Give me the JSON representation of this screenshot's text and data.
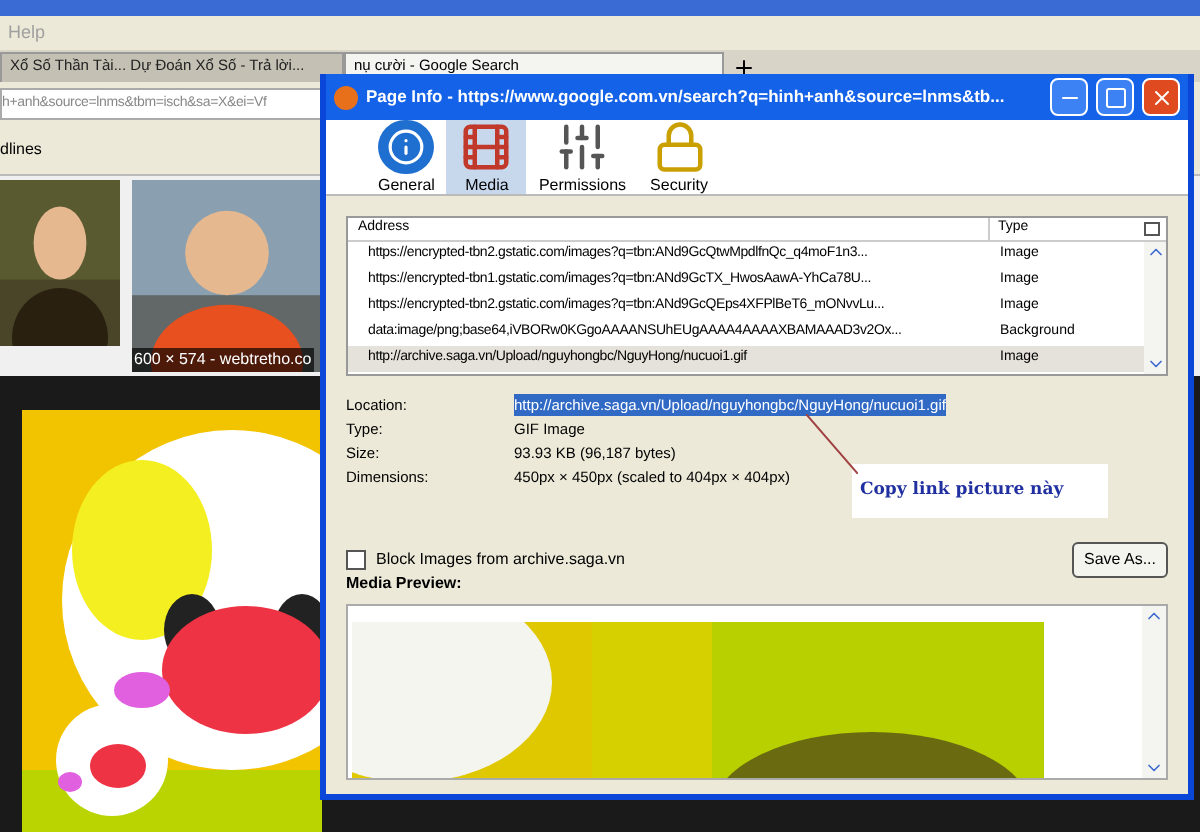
{
  "browser": {
    "menu": [
      "Help"
    ],
    "tabs": [
      {
        "label": "Xổ Số Thần Tài... Dự Đoán Xổ Số - Trả lời...",
        "selected": false
      },
      {
        "label": "nụ cười - Google Search",
        "selected": true
      }
    ],
    "address": "h+anh&source=lnms&tbm=isch&sa=X&ei=Vf",
    "bookmarks_label": "dlines",
    "image_caption": "600 × 574 - webtretho.co"
  },
  "dialog": {
    "title": "Page Info - https://www.google.com.vn/search?q=hinh+anh&source=lnms&tb...",
    "tabs": [
      {
        "label": "General",
        "kind": "general",
        "selected": false
      },
      {
        "label": "Media",
        "kind": "media",
        "selected": true
      },
      {
        "label": "Permissions",
        "kind": "permissions",
        "selected": false
      },
      {
        "label": "Security",
        "kind": "security",
        "selected": false
      }
    ],
    "list": {
      "columns": [
        "Address",
        "Type"
      ],
      "rows": [
        {
          "address": "https://encrypted-tbn2.gstatic.com/images?q=tbn:ANd9GcQtwMpdlfnQc_q4moF1n3...",
          "type": "Image",
          "selected": false
        },
        {
          "address": "https://encrypted-tbn1.gstatic.com/images?q=tbn:ANd9GcTX_HwosAawA-YhCa78U...",
          "type": "Image",
          "selected": false
        },
        {
          "address": "https://encrypted-tbn2.gstatic.com/images?q=tbn:ANd9GcQEps4XFPlBeT6_mONvvLu...",
          "type": "Image",
          "selected": false
        },
        {
          "address": "data:image/png;base64,iVBORw0KGgoAAAANSUhEUgAAAA4AAAAXBAMAAAD3v2Ox...",
          "type": "Background",
          "selected": false
        },
        {
          "address": "http://archive.saga.vn/Upload/nguyhongbc/NguyHong/nucuoi1.gif",
          "type": "Image",
          "selected": true
        }
      ]
    },
    "details": [
      {
        "label": "Location:",
        "value": "http://archive.saga.vn/Upload/nguyhongbc/NguyHong/nucuoi1.gif",
        "highlighted": true
      },
      {
        "label": "Type:",
        "value": "GIF Image",
        "highlighted": false
      },
      {
        "label": "Size:",
        "value": "93.93 KB (96,187 bytes)",
        "highlighted": false
      },
      {
        "label": "Dimensions:",
        "value": "450px × 450px (scaled to 404px × 404px)",
        "highlighted": false
      }
    ],
    "annotation": "Copy link picture này",
    "block_checkbox": {
      "label": "Block Images from archive.saga.vn",
      "checked": false
    },
    "preview_label": "Media Preview:",
    "save_button": "Save As..."
  }
}
